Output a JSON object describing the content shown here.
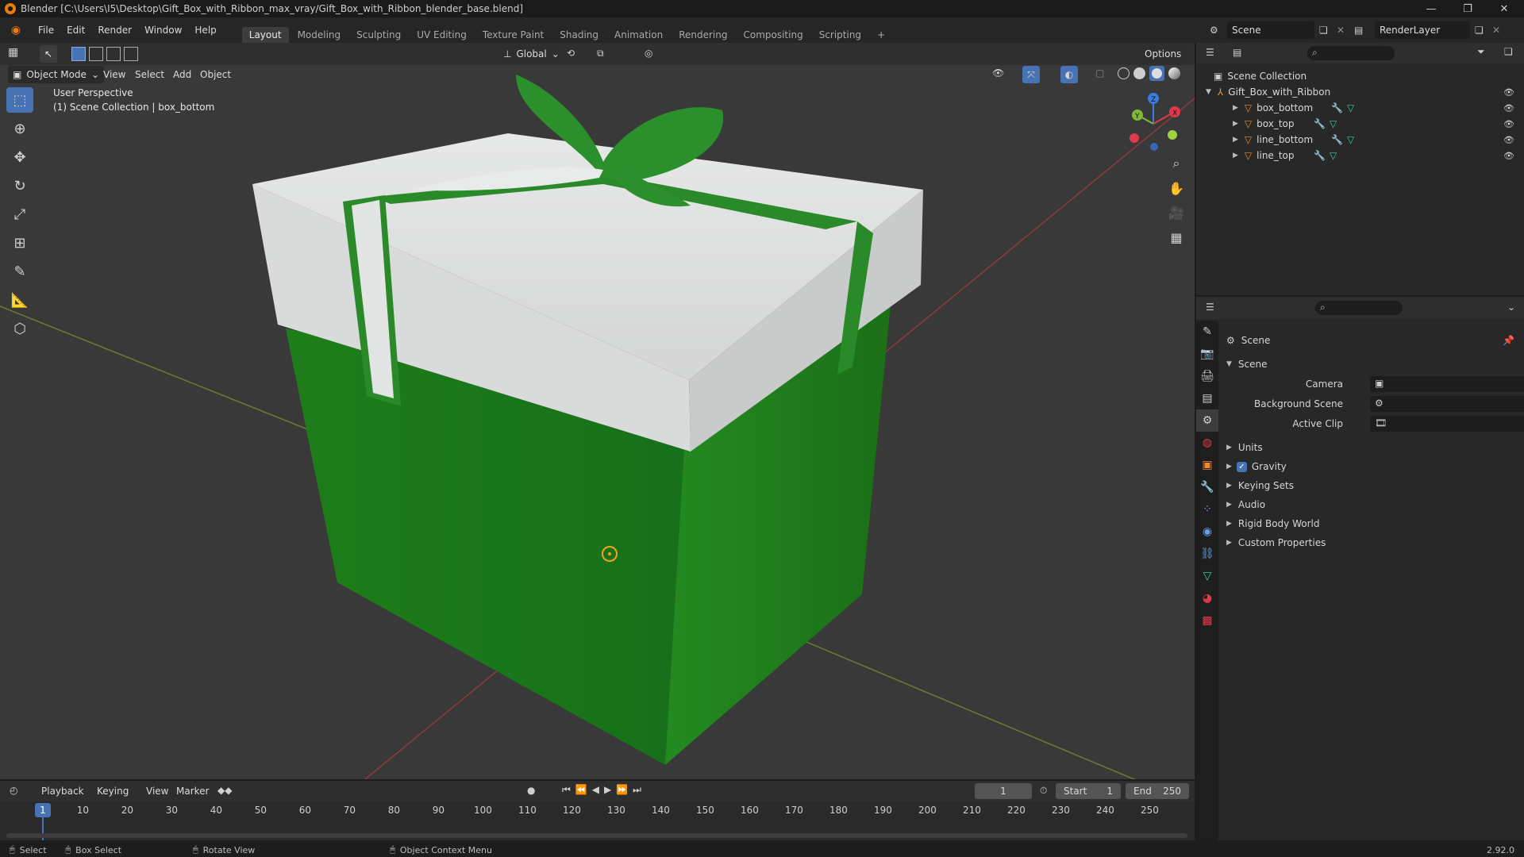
{
  "window": {
    "title": "Blender [C:\\Users\\I5\\Desktop\\Gift_Box_with_Ribbon_max_vray/Gift_Box_with_Ribbon_blender_base.blend]",
    "minimize": "—",
    "restore": "❐",
    "close": "✕"
  },
  "menus": [
    "File",
    "Edit",
    "Render",
    "Window",
    "Help"
  ],
  "workspace_tabs": [
    "Layout",
    "Modeling",
    "Sculpting",
    "UV Editing",
    "Texture Paint",
    "Shading",
    "Animation",
    "Rendering",
    "Compositing",
    "Scripting"
  ],
  "active_tab": "Layout",
  "add_tab": "+",
  "scene_selector": {
    "value": "Scene"
  },
  "render_layer": {
    "value": "RenderLayer"
  },
  "viewport": {
    "transform_orientation": "Global",
    "options": "Options",
    "mode": "Object Mode",
    "menus": [
      "View",
      "Select",
      "Add",
      "Object"
    ],
    "label_line1": "User Perspective",
    "label_line2": "(1) Scene Collection | box_bottom",
    "gizmo": {
      "x": "X",
      "y": "Y",
      "z": "Z"
    }
  },
  "outliner": {
    "root": "Scene Collection",
    "collection": "Gift_Box_with_Ribbon",
    "objects": [
      "box_bottom",
      "box_top",
      "line_bottom",
      "line_top"
    ]
  },
  "properties": {
    "header": "Scene",
    "panel": "Scene",
    "fields": [
      {
        "label": "Camera"
      },
      {
        "label": "Background Scene"
      },
      {
        "label": "Active Clip"
      }
    ],
    "sections": [
      "Units",
      "Gravity",
      "Keying Sets",
      "Audio",
      "Rigid Body World",
      "Custom Properties"
    ],
    "gravity_checked": true
  },
  "timeline": {
    "menus": [
      "Playback",
      "Keying",
      "View",
      "Marker"
    ],
    "current_frame": "1",
    "start_label": "Start",
    "start": "1",
    "end_label": "End",
    "end": "250",
    "ticks": [
      "1",
      "10",
      "20",
      "30",
      "40",
      "50",
      "60",
      "70",
      "80",
      "90",
      "100",
      "110",
      "120",
      "130",
      "140",
      "150",
      "160",
      "170",
      "180",
      "190",
      "200",
      "210",
      "220",
      "230",
      "240",
      "250"
    ]
  },
  "statusbar": {
    "select": "Select",
    "box_select": "Box Select",
    "rotate_view": "Rotate View",
    "context_menu": "Object Context Menu",
    "version": "2.92.0"
  },
  "colors": {
    "accent": "#4772b3",
    "box_green": "#1e7d1a",
    "lid_white": "#d7d9d9",
    "ribbon_green": "#2a8a2a",
    "x_axis": "#e0394b",
    "y_axis": "#7fb935",
    "z_axis": "#3c7ce0"
  }
}
